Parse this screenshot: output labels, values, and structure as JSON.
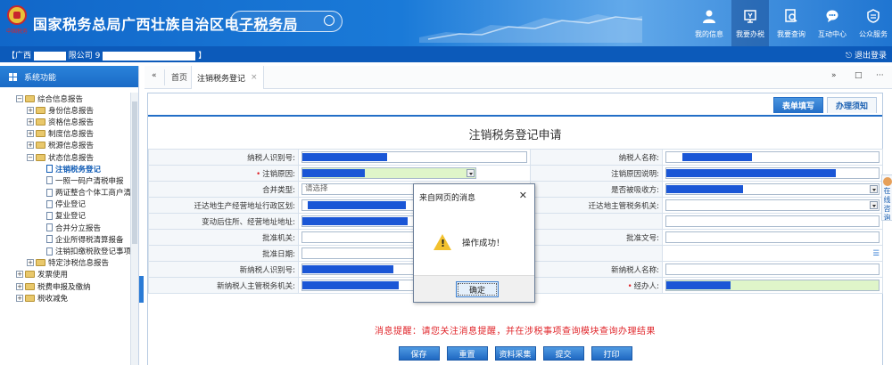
{
  "header": {
    "site_title": "国家税务总局广西壮族自治区电子税务局",
    "emblem_sub": "中国税务",
    "search_placeholder": "",
    "nav": [
      {
        "label": "我的信息",
        "icon": "user-icon"
      },
      {
        "label": "我要办税",
        "icon": "tax-screen-icon"
      },
      {
        "label": "我要查询",
        "icon": "query-icon"
      },
      {
        "label": "互动中心",
        "icon": "chat-icon"
      },
      {
        "label": "公众服务",
        "icon": "service-icon"
      }
    ]
  },
  "info_bar": {
    "user_prefix": "【广西",
    "user_mid": "限公司",
    "user_num": "9",
    "user_suffix": "】",
    "logout": "退出登录"
  },
  "sidebar": {
    "title": "系统功能",
    "tree": [
      {
        "level": 0,
        "toggle": "−",
        "type": "folder",
        "label": "综合信息报告"
      },
      {
        "level": 1,
        "toggle": "+",
        "type": "folder",
        "label": "身份信息报告"
      },
      {
        "level": 1,
        "toggle": "+",
        "type": "folder",
        "label": "资格信息报告"
      },
      {
        "level": 1,
        "toggle": "+",
        "type": "folder",
        "label": "制度信息报告"
      },
      {
        "level": 1,
        "toggle": "+",
        "type": "folder",
        "label": "税源信息报告"
      },
      {
        "level": 1,
        "toggle": "−",
        "type": "folder",
        "label": "状态信息报告"
      },
      {
        "level": 2,
        "toggle": "",
        "type": "doc",
        "label": "注销税务登记",
        "active": true
      },
      {
        "level": 2,
        "toggle": "",
        "type": "doc",
        "label": "一照一码户清税申报"
      },
      {
        "level": 2,
        "toggle": "",
        "type": "doc",
        "label": "两证整合个体工商户清税申"
      },
      {
        "level": 2,
        "toggle": "",
        "type": "doc",
        "label": "停业登记"
      },
      {
        "level": 2,
        "toggle": "",
        "type": "doc",
        "label": "复业登记"
      },
      {
        "level": 2,
        "toggle": "",
        "type": "doc",
        "label": "合并分立报告"
      },
      {
        "level": 2,
        "toggle": "",
        "type": "doc",
        "label": "企业所得税清算报备"
      },
      {
        "level": 2,
        "toggle": "",
        "type": "doc",
        "label": "注销扣缴税款登记事项"
      },
      {
        "level": 1,
        "toggle": "+",
        "type": "folder",
        "label": "特定涉税信息报告"
      },
      {
        "level": 0,
        "toggle": "+",
        "type": "folder",
        "label": "发票使用"
      },
      {
        "level": 0,
        "toggle": "+",
        "type": "folder",
        "label": "税费申报及缴纳"
      },
      {
        "level": 0,
        "toggle": "+",
        "type": "folder",
        "label": "税收减免"
      }
    ]
  },
  "tabs": {
    "prev": "«",
    "home": "首页",
    "active": "注销税务登记",
    "close": "×",
    "next": "»",
    "square": "□",
    "more": "···"
  },
  "content": {
    "sub_tabs": [
      "表单填写",
      "办理须知"
    ],
    "form_title": "注销税务登记申请",
    "rows": [
      {
        "l1": "纳税人识别号:",
        "l2": "纳税人名称:"
      },
      {
        "l1": "注销原因:",
        "l2": "注销原因说明:"
      },
      {
        "l1": "合并类型:",
        "l2": "是否被吸收方:",
        "ph": "请选择"
      },
      {
        "l1": "迁达地生产经营地址行政区划:",
        "l2": "迁达地主管税务机关:"
      },
      {
        "l1": "变动后住所、经营地址地址:",
        "l2": ""
      },
      {
        "l1": "批准机关:",
        "l2": "批准文号:"
      },
      {
        "l1": "批准日期:",
        "l2": ""
      },
      {
        "l1": "新纳税人识别号:",
        "l2": "新纳税人名称:"
      },
      {
        "l1": "新纳税人主管税务机关:",
        "l2": "经办人:"
      }
    ],
    "notice": "消息提醒：请您关注消息提醒，并在涉税事项查询模块查询办理结果",
    "buttons": [
      "保存",
      "重置",
      "资料采集",
      "提交",
      "打印"
    ]
  },
  "dialog": {
    "title": "来自网页的消息",
    "close": "✕",
    "message": "操作成功！",
    "ok": "确定"
  },
  "float_help": "在线咨询",
  "colors": {
    "header_blue": "#1a7ad8",
    "info_bar": "#0c5aba",
    "accent": "#236ec7",
    "required": "#e0262b",
    "required_bg": "#dff5c9",
    "mask_blue": "#1a56d6"
  }
}
